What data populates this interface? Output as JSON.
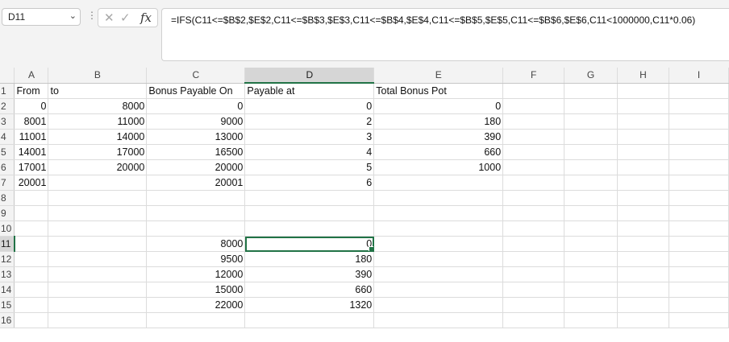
{
  "name_box": {
    "value": "D11",
    "arrow_icon": "chevron-down-icon"
  },
  "formula_bar": {
    "cancel_icon": "✕",
    "enter_icon": "✓",
    "fx_label": "fx",
    "formula": "=IFS(C11<=$B$2,$E$2,C11<=$B$3,$E$3,C11<=$B$4,$E$4,C11<=$B$5,$E$5,C11<=$B$6,$E$6,C11<1000000,C11*0.06)"
  },
  "columns": [
    "A",
    "B",
    "C",
    "D",
    "E",
    "F",
    "G",
    "H",
    "I"
  ],
  "selected_column": "D",
  "selected_row": "11",
  "rows": [
    {
      "row": "1",
      "cells": [
        "From",
        "to",
        "Bonus Payable On",
        "Payable at",
        "Total Bonus Pot",
        "",
        "",
        "",
        ""
      ]
    },
    {
      "row": "2",
      "cells": [
        "0",
        "8000",
        "0",
        "0",
        "0",
        "",
        "",
        "",
        ""
      ]
    },
    {
      "row": "3",
      "cells": [
        "8001",
        "11000",
        "9000",
        "2",
        "180",
        "",
        "",
        "",
        ""
      ]
    },
    {
      "row": "4",
      "cells": [
        "11001",
        "14000",
        "13000",
        "3",
        "390",
        "",
        "",
        "",
        ""
      ]
    },
    {
      "row": "5",
      "cells": [
        "14001",
        "17000",
        "16500",
        "4",
        "660",
        "",
        "",
        "",
        ""
      ]
    },
    {
      "row": "6",
      "cells": [
        "17001",
        "20000",
        "20000",
        "5",
        "1000",
        "",
        "",
        "",
        ""
      ]
    },
    {
      "row": "7",
      "cells": [
        "20001",
        "",
        "20001",
        "6",
        "",
        "",
        "",
        "",
        ""
      ]
    },
    {
      "row": "8",
      "cells": [
        "",
        "",
        "",
        "",
        "",
        "",
        "",
        "",
        ""
      ]
    },
    {
      "row": "9",
      "cells": [
        "",
        "",
        "",
        "",
        "",
        "",
        "",
        "",
        ""
      ]
    },
    {
      "row": "10",
      "cells": [
        "",
        "",
        "",
        "",
        "",
        "",
        "",
        "",
        ""
      ]
    },
    {
      "row": "11",
      "cells": [
        "",
        "",
        "8000",
        "0",
        "",
        "",
        "",
        "",
        ""
      ]
    },
    {
      "row": "12",
      "cells": [
        "",
        "",
        "9500",
        "180",
        "",
        "",
        "",
        "",
        ""
      ]
    },
    {
      "row": "13",
      "cells": [
        "",
        "",
        "12000",
        "390",
        "",
        "",
        "",
        "",
        ""
      ]
    },
    {
      "row": "14",
      "cells": [
        "",
        "",
        "15000",
        "660",
        "",
        "",
        "",
        "",
        ""
      ]
    },
    {
      "row": "15",
      "cells": [
        "",
        "",
        "22000",
        "1320",
        "",
        "",
        "",
        "",
        ""
      ]
    },
    {
      "row": "16",
      "cells": [
        "",
        "",
        "",
        "",
        "",
        "",
        "",
        "",
        ""
      ]
    }
  ],
  "accent_color": "#217346"
}
